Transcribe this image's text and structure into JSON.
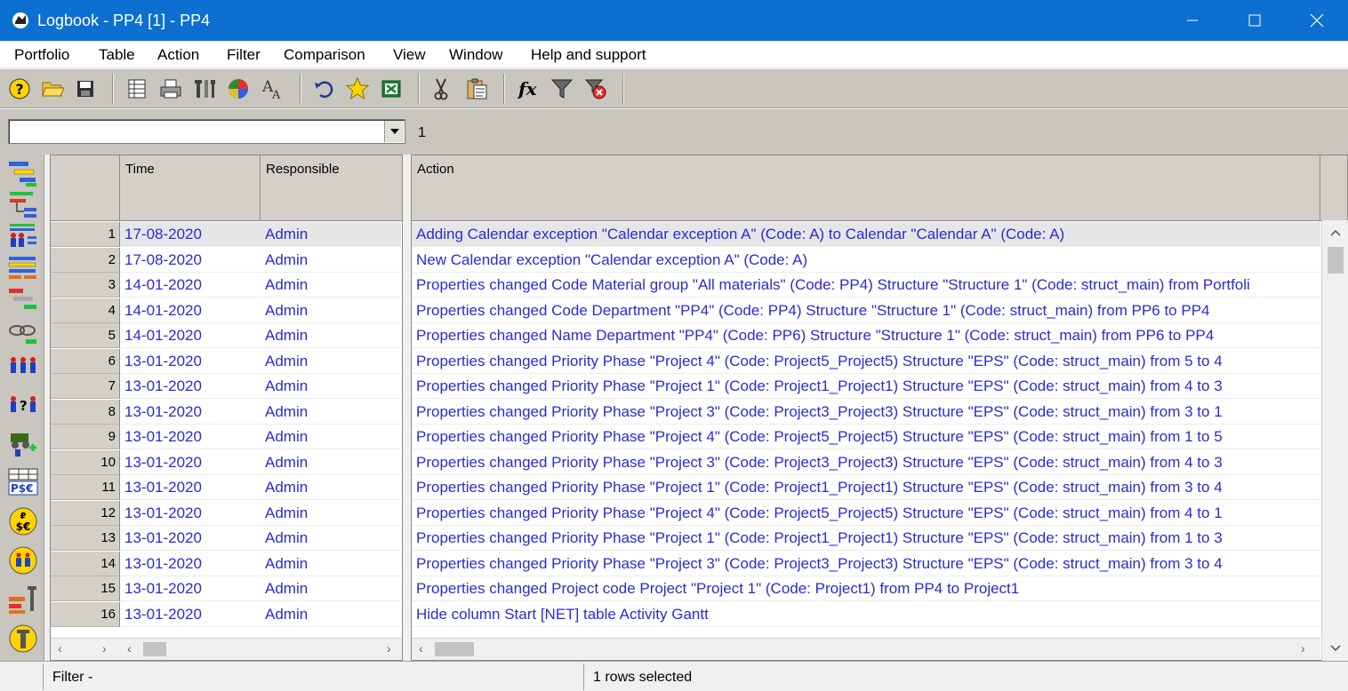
{
  "window": {
    "title": "Logbook - PP4 [1] - PP4",
    "controls": [
      "minimize-icon",
      "maximize-icon",
      "close-icon"
    ]
  },
  "menu": [
    "Portfolio",
    "Table",
    "Action",
    "Filter",
    "Comparison",
    "View",
    "Window",
    "Help and support"
  ],
  "toolbar": {
    "icons": [
      "help-icon",
      "open-folder-icon",
      "save-icon",
      "table-icon",
      "print-icon",
      "settings-icon",
      "chart-icon",
      "font-icon",
      "undo-icon",
      "favorite-star-icon",
      "excel-export-icon",
      "cut-icon",
      "paste-icon",
      "formula-icon",
      "filter-icon",
      "clear-filter-icon"
    ]
  },
  "filter": {
    "value": "",
    "count": "1"
  },
  "left_strip": {
    "icons": [
      "gantt-icon",
      "hierarchy-icon",
      "resources-icon",
      "structure-icon",
      "bars-icon",
      "links-icon",
      "team-icon",
      "team-question-icon",
      "machine-add-icon",
      "currency-table-icon",
      "currency-coin-icon",
      "team-coin-icon",
      "tools-bars-icon",
      "tools-coin-icon"
    ]
  },
  "table": {
    "columns": {
      "time": "Time",
      "responsible": "Responsible",
      "action": "Action"
    },
    "rows": [
      {
        "n": "1",
        "time": "17-08-2020",
        "responsible": "Admin",
        "action": "Adding Calendar exception \"Calendar exception A\" (Code: A) to Calendar \"Calendar A\" (Code: A)"
      },
      {
        "n": "2",
        "time": "17-08-2020",
        "responsible": "Admin",
        "action": "New Calendar exception \"Calendar exception A\" (Code: A)"
      },
      {
        "n": "3",
        "time": "14-01-2020",
        "responsible": "Admin",
        "action": "Properties changed Code Material group \"All materials\" (Code: PP4) Structure \"Structure 1\" (Code: struct_main) from Portfoli"
      },
      {
        "n": "4",
        "time": "14-01-2020",
        "responsible": "Admin",
        "action": "Properties changed Code Department \"PP4\" (Code: PP4) Structure \"Structure 1\" (Code: struct_main) from PP6 to PP4"
      },
      {
        "n": "5",
        "time": "14-01-2020",
        "responsible": "Admin",
        "action": "Properties changed Name Department \"PP4\" (Code: PP6) Structure \"Structure 1\" (Code: struct_main) from PP6 to PP4"
      },
      {
        "n": "6",
        "time": "13-01-2020",
        "responsible": "Admin",
        "action": "Properties changed Priority Phase \"Project 4\" (Code: Project5_Project5) Structure \"EPS\" (Code: struct_main) from 5 to 4"
      },
      {
        "n": "7",
        "time": "13-01-2020",
        "responsible": "Admin",
        "action": "Properties changed Priority Phase \"Project 1\" (Code: Project1_Project1) Structure \"EPS\" (Code: struct_main) from 4 to 3"
      },
      {
        "n": "8",
        "time": "13-01-2020",
        "responsible": "Admin",
        "action": "Properties changed Priority Phase \"Project 3\" (Code: Project3_Project3) Structure \"EPS\" (Code: struct_main) from 3 to 1"
      },
      {
        "n": "9",
        "time": "13-01-2020",
        "responsible": "Admin",
        "action": "Properties changed Priority Phase \"Project 4\" (Code: Project5_Project5) Structure \"EPS\" (Code: struct_main) from 1 to 5"
      },
      {
        "n": "10",
        "time": "13-01-2020",
        "responsible": "Admin",
        "action": "Properties changed Priority Phase \"Project 3\" (Code: Project3_Project3) Structure \"EPS\" (Code: struct_main) from 4 to 3"
      },
      {
        "n": "11",
        "time": "13-01-2020",
        "responsible": "Admin",
        "action": "Properties changed Priority Phase \"Project 1\" (Code: Project1_Project1) Structure \"EPS\" (Code: struct_main) from 3 to 4"
      },
      {
        "n": "12",
        "time": "13-01-2020",
        "responsible": "Admin",
        "action": "Properties changed Priority Phase \"Project 4\" (Code: Project5_Project5) Structure \"EPS\" (Code: struct_main) from 4 to 1"
      },
      {
        "n": "13",
        "time": "13-01-2020",
        "responsible": "Admin",
        "action": "Properties changed Priority Phase \"Project 1\" (Code: Project1_Project1) Structure \"EPS\" (Code: struct_main) from 1 to 3"
      },
      {
        "n": "14",
        "time": "13-01-2020",
        "responsible": "Admin",
        "action": "Properties changed Priority Phase \"Project 3\" (Code: Project3_Project3) Structure \"EPS\" (Code: struct_main) from 3 to 4"
      },
      {
        "n": "15",
        "time": "13-01-2020",
        "responsible": "Admin",
        "action": "Properties changed Project code Project \"Project 1\" (Code: Project1) from PP4 to Project1"
      },
      {
        "n": "16",
        "time": "13-01-2020",
        "responsible": "Admin",
        "action": "Hide column Start [NET] table Activity Gantt"
      }
    ],
    "selected_row": "1"
  },
  "status": {
    "filter_label": "Filter -",
    "selection_text": "1 rows selected"
  },
  "colors": {
    "titlebar": "#0c6fd1",
    "cell_text": "#2b2bd3",
    "chrome": "#c8c6be",
    "header": "#d4d0c8"
  }
}
